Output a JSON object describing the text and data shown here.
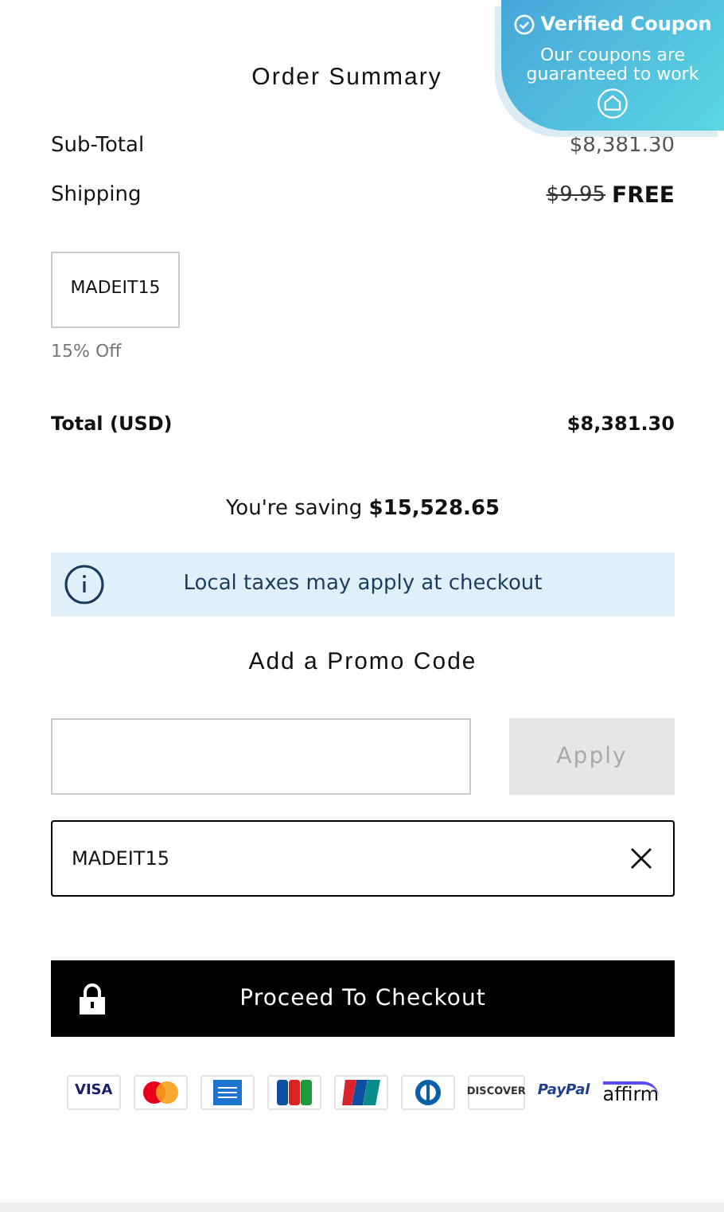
{
  "coupon_badge": {
    "title": "Verified Coupon",
    "text": "Our coupons are guaranteed to work"
  },
  "summary": {
    "title": "Order Summary",
    "rows": [
      {
        "label": "Sub-Total",
        "value": "$8,381.30"
      },
      {
        "label": "Shipping",
        "old_value": "$9.95",
        "value": "FREE"
      }
    ],
    "applied_code": "MADEIT15",
    "discount": "15% Off",
    "total_label": "Total (USD)",
    "total": "$8,381.30",
    "saving": "You're saving **$15,528.65**"
  },
  "notice": "Local taxes may apply at checkout",
  "promo": {
    "title": "Add a Promo Code",
    "apply_button": {
      "label": "Apply",
      "disabled": true
    },
    "applied_code": "MADEIT15"
  },
  "checkout_button": "Proceed To Checkout",
  "payment_methods": [
    {
      "kind": "visa",
      "label": "VISA"
    },
    {
      "kind": "mastercard"
    },
    {
      "kind": "amex"
    },
    {
      "kind": "jcb"
    },
    {
      "kind": "unionpay"
    },
    {
      "kind": "diners"
    },
    {
      "kind": "discover",
      "label": "DISCOVER"
    },
    {
      "kind": "paypal",
      "label": "PayPal"
    },
    {
      "kind": "affirm",
      "label": "affirm"
    }
  ]
}
